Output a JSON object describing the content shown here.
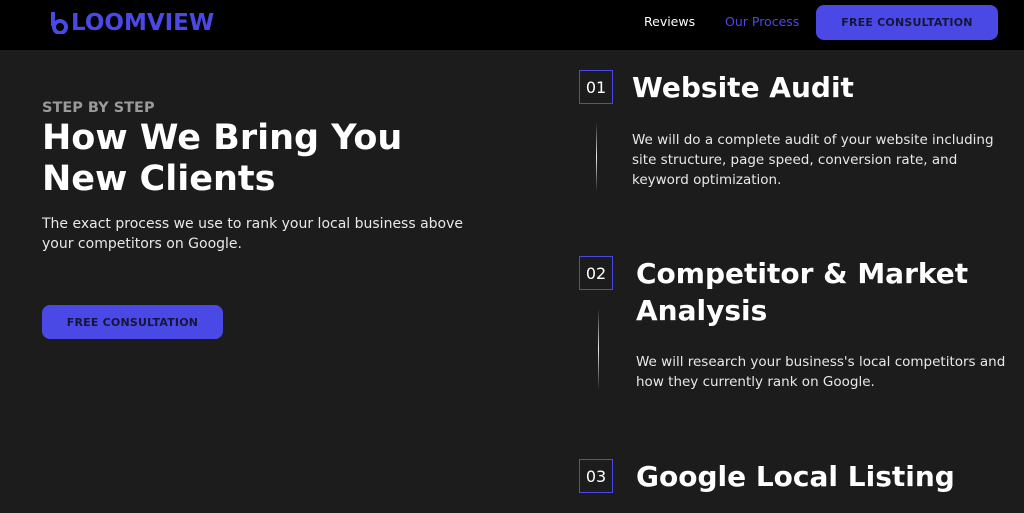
{
  "header": {
    "logo_text": "LOOMVIEW",
    "nav": {
      "reviews": "Reviews",
      "our_process": "Our Process"
    },
    "cta_label": "FREE CONSULTATION"
  },
  "hero": {
    "eyebrow": "STEP BY STEP",
    "title": "How We Bring You New Clients",
    "description": "The exact process we use to rank your local business above your competitors on Google.",
    "cta_label": "FREE CONSULTATION"
  },
  "steps": [
    {
      "number": "01",
      "title": "Website Audit",
      "description": "We will do a complete audit of your website including site structure, page speed, conversion rate, and keyword optimization."
    },
    {
      "number": "02",
      "title": "Competitor & Market Analysis",
      "description": "We will research your business's local competitors and how they currently rank on Google."
    },
    {
      "number": "03",
      "title": "Google Local Listing"
    }
  ],
  "colors": {
    "accent": "#4b49e6",
    "page_background": "#1c1c1c",
    "header_background": "#000000"
  }
}
